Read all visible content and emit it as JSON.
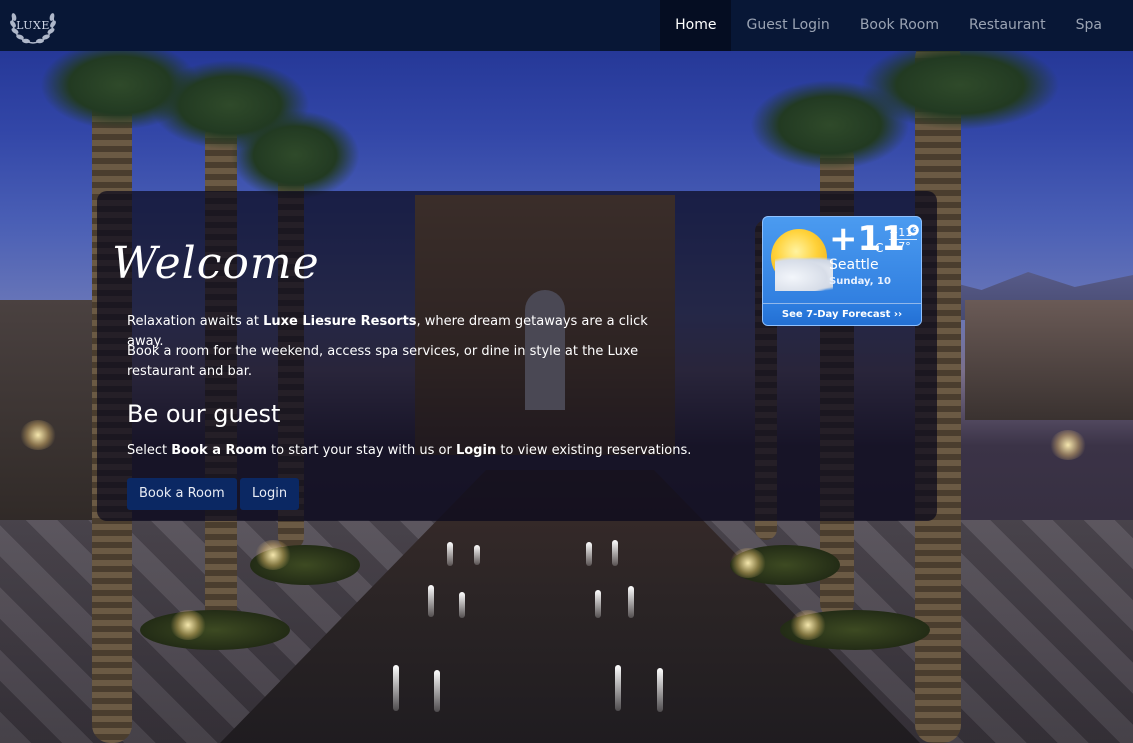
{
  "brand": {
    "logo_text": "LUXE"
  },
  "nav": {
    "items": [
      {
        "label": "Home",
        "active": true
      },
      {
        "label": "Guest Login",
        "active": false
      },
      {
        "label": "Book Room",
        "active": false
      },
      {
        "label": "Restaurant",
        "active": false
      },
      {
        "label": "Spa",
        "active": false
      }
    ]
  },
  "hero": {
    "welcome": "Welcome",
    "intro_prefix": "Relaxation awaits at ",
    "intro_bold": "Luxe Liesure Resorts",
    "intro_suffix": ", where dream getaways are a click away.",
    "services_text": "Book a room for the weekend, access spa services, or dine in style at the  Luxe restaurant and bar.",
    "guest_heading": "Be our guest",
    "guest_prefix": "Select ",
    "guest_bold_1": "Book a  Room",
    "guest_middle": " to start your stay with us or ",
    "guest_bold_2": "Login",
    "guest_suffix": " to view existing reservations.",
    "book_button": "Book a Room",
    "login_button": "Login"
  },
  "weather": {
    "temp": "+11°",
    "unit": "C",
    "high": "+11°",
    "low": "+7°",
    "city": "Seattle",
    "date": "Sunday, 10",
    "forecast_link": "See 7-Day Forecast ››"
  },
  "colors": {
    "navbar": "#081736",
    "button": "#0b2863",
    "weather_accent": "#2a78dc"
  }
}
